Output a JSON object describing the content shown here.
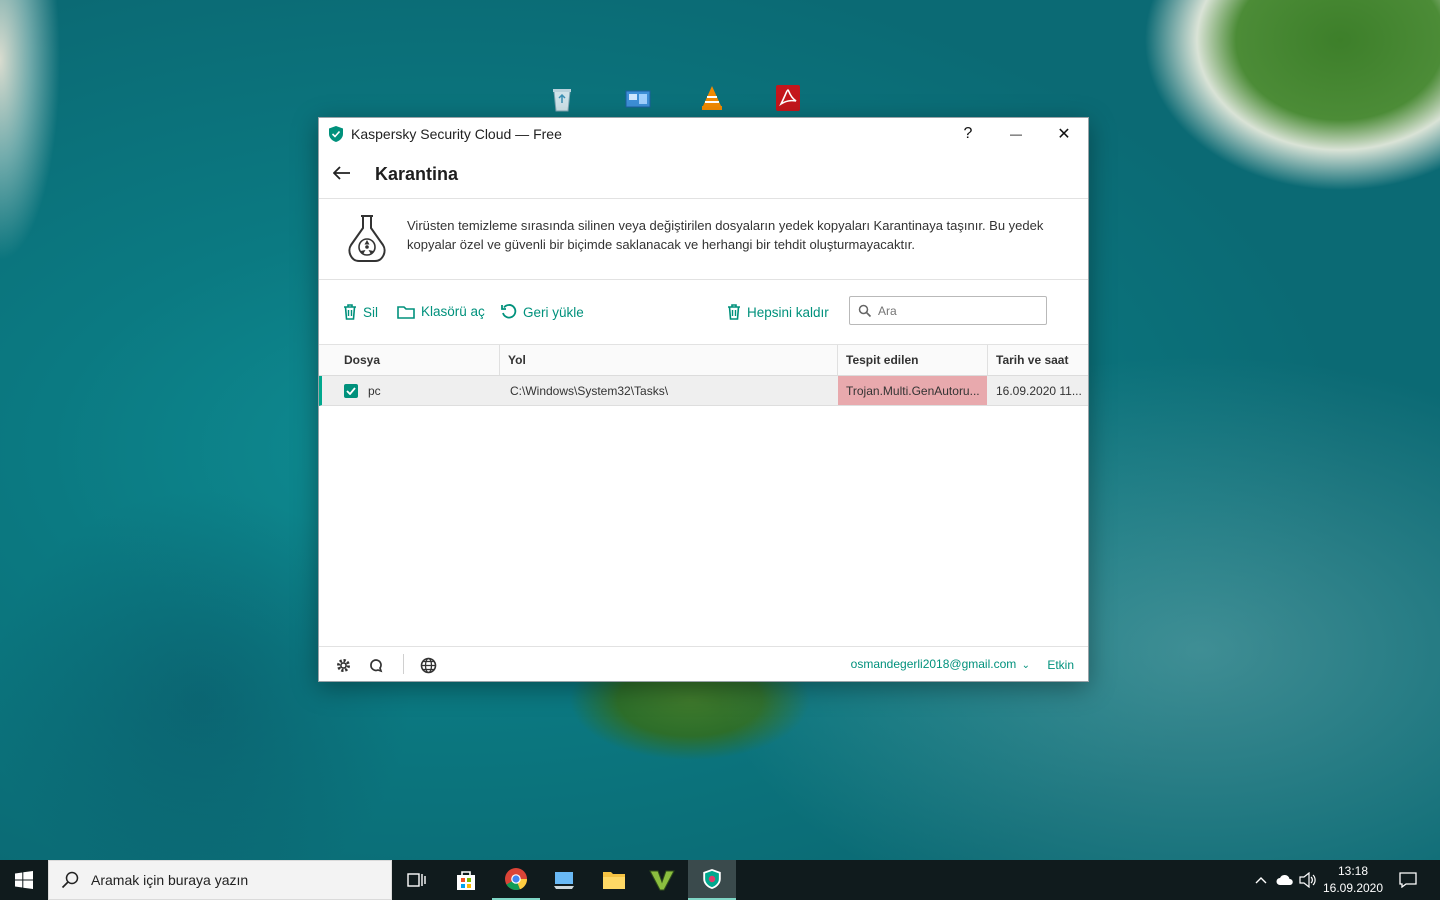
{
  "window": {
    "title": "Kaspersky Security Cloud — Free",
    "help_label": "?",
    "minimize_label": "—",
    "close_label": "✕"
  },
  "header": {
    "title": "Karantina"
  },
  "info": {
    "text": "Virüsten temizleme sırasında silinen veya değiştirilen dosyaların yedek kopyaları Karantinaya taşınır. Bu yedek kopyalar özel ve güvenli bir biçimde saklanacak ve herhangi bir tehdit oluşturmayacaktır."
  },
  "toolbar": {
    "delete_label": "Sil",
    "open_folder_label": "Klasörü aç",
    "restore_label": "Geri yükle",
    "remove_all_label": "Hepsini kaldır",
    "search_placeholder": "Ara"
  },
  "table": {
    "columns": [
      "Dosya",
      "Yol",
      "Tespit edilen",
      "Tarih ve saat"
    ],
    "rows": [
      {
        "checked": true,
        "file": "pc",
        "path": "C:\\Windows\\System32\\Tasks\\",
        "detected": "Trojan.Multi.GenAutoru...",
        "datetime": "16.09.2020 11..."
      }
    ]
  },
  "footer": {
    "account": "osmandegerli2018@gmail.com",
    "status": "Etkin"
  },
  "taskbar": {
    "search_placeholder": "Aramak için buraya yazın",
    "time": "13:18",
    "date": "16.09.2020"
  },
  "colors": {
    "accent": "#00917c",
    "threat_bg": "#e8a9ad",
    "taskbar": "#101b1d"
  }
}
